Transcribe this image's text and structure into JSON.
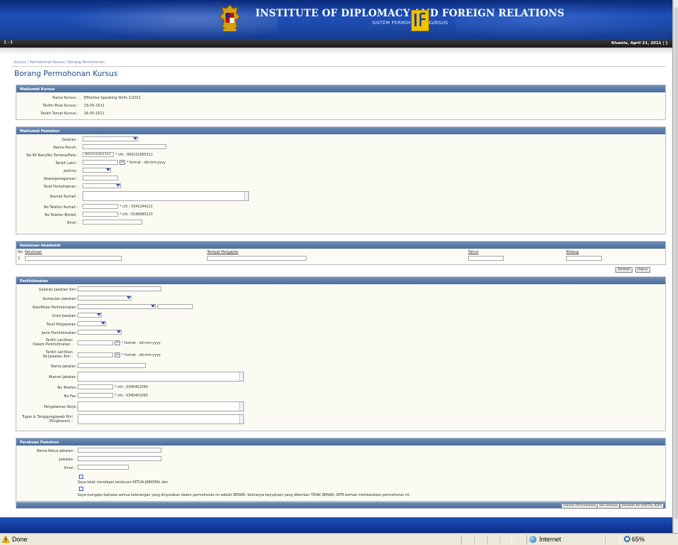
{
  "banner": {
    "title": "INSTITUTE OF DIPLOMACY AND FOREIGN RELATIONS",
    "subtitle": "SISTEM PERMOHONAN KURSUS"
  },
  "strip": {
    "menu": "[ - ]",
    "date": "Khamis, April 21, 2011 | ]"
  },
  "breadcrumb": "Kursus / Permohonan Kursus / Borang Permohonan",
  "page_title": "Borang Permohonan Kursus",
  "maklumat_kursus": {
    "heading": "Maklumat Kursus",
    "nama_label": "Nama Kursus :",
    "nama_value": "Effective Speaking Skills 1/2011",
    "mula_label": "Tarikh Mula Kursus :",
    "mula_value": "23-05-2011",
    "tamat_label": "Tarikh Tamat Kursus :",
    "tamat_value": "26-05-2011"
  },
  "maklumat_pemohon": {
    "heading": "Maklumat Pemohon",
    "gelaran": "Gelaran :",
    "nama_penuh": "Nama Penuh :",
    "no_kp": "No KP Baru/No Tentera/Polis :",
    "no_kp_value": "900101063333",
    "no_kp_note": "* cth : 900101065311",
    "tarikh_lahir": "Tarikh Lahir :",
    "tarikh_lahir_note": "* format : dd-mm-yyyy",
    "jantina": "Jantina :",
    "kewarganegaraan": "Kewarganegaraan :",
    "taraf_perkahwinan": "Taraf Perkahwinan :",
    "alamat_rumah": "Alamat Rumah :",
    "tel_rumah": "No Telefon Rumah :",
    "tel_rumah_note": "* cth : 0341244211",
    "tel_bimbit": "No Telefon Bimbit :",
    "tel_bimbit_note": "* cth : 0198080123",
    "emel": "Emel :"
  },
  "kelulusan": {
    "heading": "Kelulusan Akademik",
    "col_no": "No",
    "col_kelulusan": "Kelulusan",
    "col_tempat": "Tempat Pengajian",
    "col_tahun": "Tahun",
    "col_bidang": "Bidang",
    "row_no": "1.",
    "tambah": "Tambah",
    "hapus": "Hapus"
  },
  "perkhidmatan": {
    "heading": "Perkhidmatan",
    "gelaran_jawatan": "Gelaran Jawatan Kini :",
    "kumpulan_jawatan": "Kumpulan Jawatan :",
    "klasifikasi": "Klasifikasi Perkhidmatan :",
    "gred": "Gred Jawatan :",
    "taraf_perjawatan": "Taraf Perjawatan :",
    "jenis": "Jenis Perkhidmatan :",
    "tarikh_lantikan_line1": "Tarikh Lantikan",
    "tarikh_lantikan_line2": "Dalam Perkhidmatan :",
    "tarikh_lantikan_note": "* format : dd-mm-yyyy",
    "tarikh_kini_line1": "Tarikh Lantikan",
    "tarikh_kini_line2": "Ke Jawatan Kini :",
    "tarikh_kini_note": "* format : dd-mm-yyyy",
    "nama_jabatan": "Nama Jabatan :",
    "alamat_jabatan": "Alamat Jabatan :",
    "no_telefon": "No Telefon :",
    "no_telefon_note": "* cth : 0340401090",
    "no_fax": "No Fax :",
    "no_fax_note": "* cth : 0340401090",
    "pengalaman": "Pengalaman Kerja :",
    "tugas_line1": "Tugas & Tanggungjawab Kini",
    "tugas_line2": "(Ringkasan) :"
  },
  "perakuan": {
    "heading": "Perakuan Pemohon",
    "nama_ketua": "Nama Ketua Jabatan :",
    "jawatan": "Jawatan :",
    "emel": "Emel :",
    "decl1": "Saya telah mendapat kelulusan KETUA JABATAN; dan",
    "decl2": "Saya mengaku bahawa semua keterangan yang dinyatakan dalam permohonan ini adalah BENAR. Sekiranya kenyataan yang diberikan TIDAK BENAR, IDFR berhak membatalkan permohonan ini."
  },
  "actions": {
    "hantar": "Hantar Permohonan",
    "set_semula": "Set Semula",
    "kembali": "Kembali Ke PORTAL IDFR"
  },
  "statusbar": {
    "done": "Done",
    "zone": "Internet",
    "zoom": "65%"
  }
}
